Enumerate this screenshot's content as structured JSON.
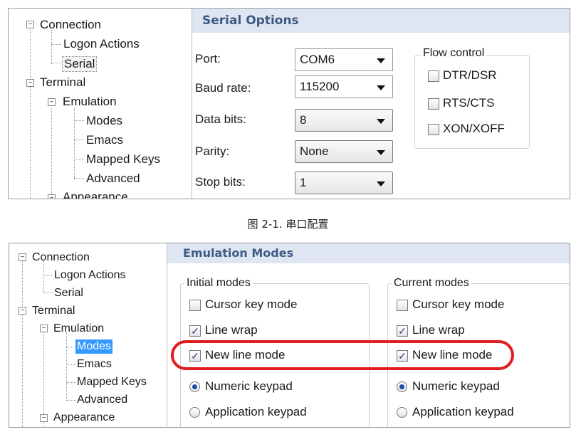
{
  "top": {
    "tree": {
      "connection": "Connection",
      "logon_actions": "Logon Actions",
      "serial": "Serial",
      "terminal": "Terminal",
      "emulation": "Emulation",
      "modes": "Modes",
      "emacs": "Emacs",
      "mapped_keys": "Mapped Keys",
      "advanced": "Advanced",
      "appearance": "Appearance"
    },
    "header": "Serial Options",
    "port_label": "Port:",
    "port_value": "COM6",
    "baud_label": "Baud rate:",
    "baud_value": "115200",
    "data_bits_label": "Data bits:",
    "data_bits_value": "8",
    "parity_label": "Parity:",
    "parity_value": "None",
    "stop_bits_label": "Stop bits:",
    "stop_bits_value": "1",
    "flow_control": {
      "title": "Flow control",
      "dtr_dsr": "DTR/DSR",
      "rts_cts": "RTS/CTS",
      "xon_xoff": "XON/XOFF"
    }
  },
  "caption": "图 2-1. 串口配置",
  "bottom": {
    "tree": {
      "connection": "Connection",
      "logon_actions": "Logon Actions",
      "serial": "Serial",
      "terminal": "Terminal",
      "emulation": "Emulation",
      "modes": "Modes",
      "emacs": "Emacs",
      "mapped_keys": "Mapped Keys",
      "advanced": "Advanced",
      "appearance": "Appearance"
    },
    "header": "Emulation Modes",
    "initial": {
      "title": "Initial modes",
      "cursor_key_mode": "Cursor key mode",
      "line_wrap": "Line wrap",
      "new_line_mode": "New line mode",
      "numeric_keypad": "Numeric keypad",
      "application_keypad": "Application keypad"
    },
    "current": {
      "title": "Current modes",
      "cursor_key_mode": "Cursor key mode",
      "line_wrap": "Line wrap",
      "new_line_mode": "New line mode",
      "numeric_keypad": "Numeric keypad",
      "application_keypad": "Application keypad"
    },
    "checkmark": "✓",
    "highlight_color": "#e01e1e"
  }
}
